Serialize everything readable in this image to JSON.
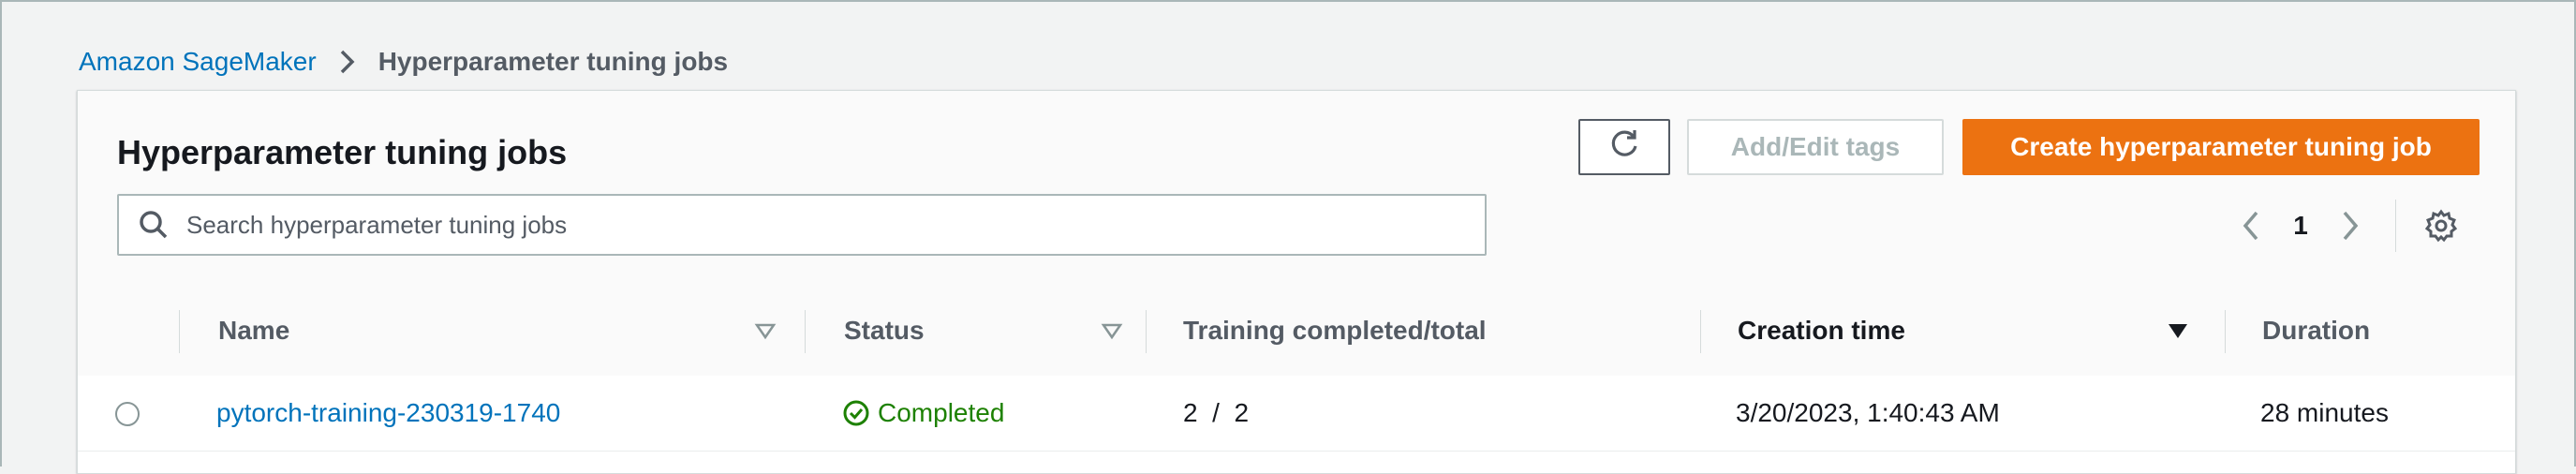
{
  "breadcrumb": {
    "root": "Amazon SageMaker",
    "current": "Hyperparameter tuning jobs"
  },
  "panel": {
    "title": "Hyperparameter tuning jobs",
    "buttons": {
      "refresh_icon": "refresh-icon",
      "add_edit_tags": "Add/Edit tags",
      "create": "Create hyperparameter tuning job"
    },
    "search": {
      "placeholder": "Search hyperparameter tuning jobs",
      "value": ""
    },
    "pagination": {
      "current_page": "1"
    }
  },
  "table": {
    "columns": [
      {
        "label": "Name"
      },
      {
        "label": "Status"
      },
      {
        "label": "Training completed/total"
      },
      {
        "label": "Creation time"
      },
      {
        "label": "Duration"
      }
    ],
    "rows": [
      {
        "name": "pytorch-training-230319-1740",
        "status": "Completed",
        "training": "2  /  2",
        "creation_time": "3/20/2023, 1:40:43 AM",
        "duration": "28 minutes"
      }
    ]
  },
  "colors": {
    "link": "#0073bb",
    "primary": "#ec7211",
    "success": "#1d8102",
    "disabled": "#aab7b8"
  }
}
